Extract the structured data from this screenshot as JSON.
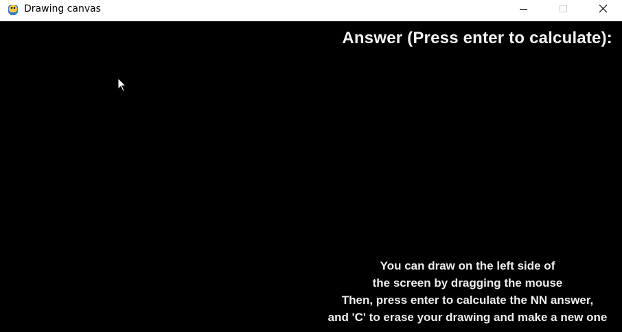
{
  "window": {
    "title": "Drawing canvas",
    "icon": "python-snake-icon"
  },
  "controls": {
    "minimize": "minimize-icon",
    "maximize": "maximize-icon",
    "close": "close-icon"
  },
  "canvas": {
    "answer_heading": "Answer (Press enter to calculate):",
    "instructions": [
      "You can draw on the left side of",
      "the screen by dragging the mouse",
      "Then, press enter to calculate the NN answer,",
      "and 'C' to erase your drawing and make a new one"
    ]
  },
  "colors": {
    "background": "#000000",
    "text": "#eeeeee",
    "titlebar": "#ffffff",
    "icon_blue": "#3e7bbf",
    "icon_yellow": "#f7c948"
  }
}
